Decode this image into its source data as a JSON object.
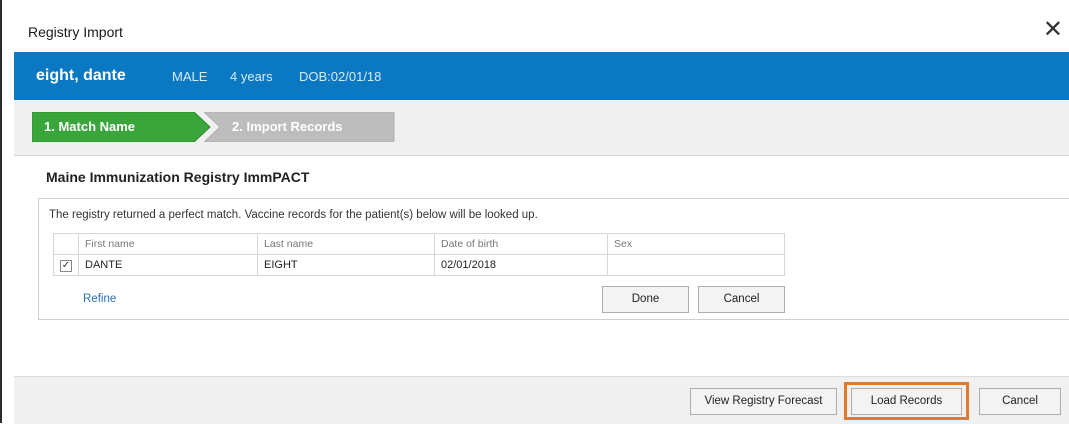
{
  "window": {
    "title": "Registry Import",
    "close_glyph": "✕"
  },
  "patient": {
    "name": "eight, dante",
    "sex": "MALE",
    "age": "4 years",
    "dob": "DOB:02/01/18"
  },
  "wizard": {
    "steps": [
      {
        "label": "1. Match Name",
        "state": "active",
        "color": "#3aa53a"
      },
      {
        "label": "2. Import Records",
        "state": "inactive",
        "color": "#bdbdbd"
      }
    ]
  },
  "registry": {
    "name": "Maine Immunization Registry ImmPACT",
    "message": "The registry returned a perfect match. Vaccine records for the patient(s) below will be looked up.",
    "columns": [
      "First name",
      "Last name",
      "Date of birth",
      "Sex"
    ],
    "rows": [
      {
        "checked": true,
        "first_name": "DANTE",
        "last_name": "EIGHT",
        "dob": "02/01/2018",
        "sex": ""
      }
    ],
    "refine_label": "Refine",
    "done_label": "Done",
    "cancel_label": "Cancel"
  },
  "footer": {
    "forecast_label": "View Registry Forecast",
    "load_label": "Load Records",
    "cancel_label": "Cancel",
    "highlight_color": "#e07a2a"
  },
  "colors": {
    "header_blue": "#0a78c2",
    "active_step": "#3aa53a",
    "inactive_step": "#bdbdbd"
  }
}
